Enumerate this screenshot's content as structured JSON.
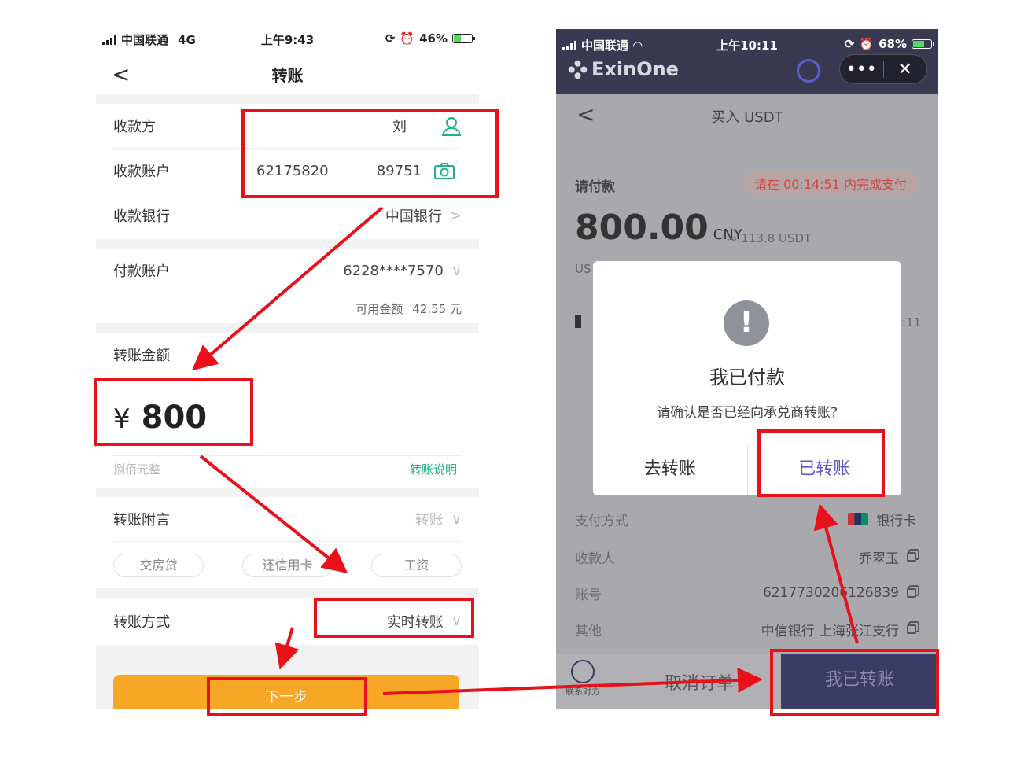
{
  "left_phone": {
    "status": {
      "carrier": "中国联通",
      "network": "4G",
      "time": "上午9:43",
      "battery": "46%",
      "battery_level": 0.46
    },
    "nav": {
      "back": "<",
      "title": "转账"
    },
    "payee": {
      "label": "收款方",
      "value": "刘"
    },
    "account": {
      "label": "收款账户",
      "value_start": "62175820",
      "value_end": "89751"
    },
    "bank": {
      "label": "收款银行",
      "value": "中国银行"
    },
    "pay_account": {
      "label": "付款账户",
      "value": "6228****7570"
    },
    "balance": {
      "label": "可用金额",
      "value": "42.55 元"
    },
    "amount": {
      "label": "转账金额",
      "currency": "¥",
      "value": "800",
      "in_words": "捌佰元整",
      "explain_link": "转账说明"
    },
    "note": {
      "label": "转账附言",
      "value": "转账",
      "chips": [
        "交房贷",
        "还信用卡",
        "工资"
      ]
    },
    "method": {
      "label": "转账方式",
      "value": "实时转账"
    },
    "next_button": "下一步"
  },
  "right_phone": {
    "status": {
      "carrier": "中国联通",
      "time": "上午10:11",
      "battery": "68%",
      "battery_level": 0.68
    },
    "app": {
      "name": "ExinOne",
      "more": "•••",
      "close": "✕"
    },
    "page": {
      "back": "<",
      "title": "买入 USDT"
    },
    "payment": {
      "label": "请付款",
      "timer": "请在 00:14:51 内完成支付",
      "amount": "800.00",
      "currency": "CNY",
      "approx": "≈ 113.8 USDT",
      "partial_left": "US",
      "partial_right": "0:11"
    },
    "details": [
      {
        "key": "支付方式",
        "value": "银行卡"
      },
      {
        "key": "收款人",
        "value": "乔翠玉"
      },
      {
        "key": "账号",
        "value": "6217730206126839"
      },
      {
        "key": "其他",
        "value": "中信银行 上海张江支行"
      }
    ],
    "bottom": {
      "contact": "联系对方",
      "cancel": "取消订单",
      "paid": "我已转账"
    },
    "dialog": {
      "icon": "!",
      "title": "我已付款",
      "message": "请确认是否已经向承兑商转账?",
      "go_transfer": "去转账",
      "transferred": "已转账"
    }
  },
  "colors": {
    "annotation": "#e8101a",
    "accent_green": "#1eb37d",
    "next_orange": "#f8a626",
    "paid_purple": "#3c3b64",
    "dialog_blue": "#5a58c8"
  }
}
